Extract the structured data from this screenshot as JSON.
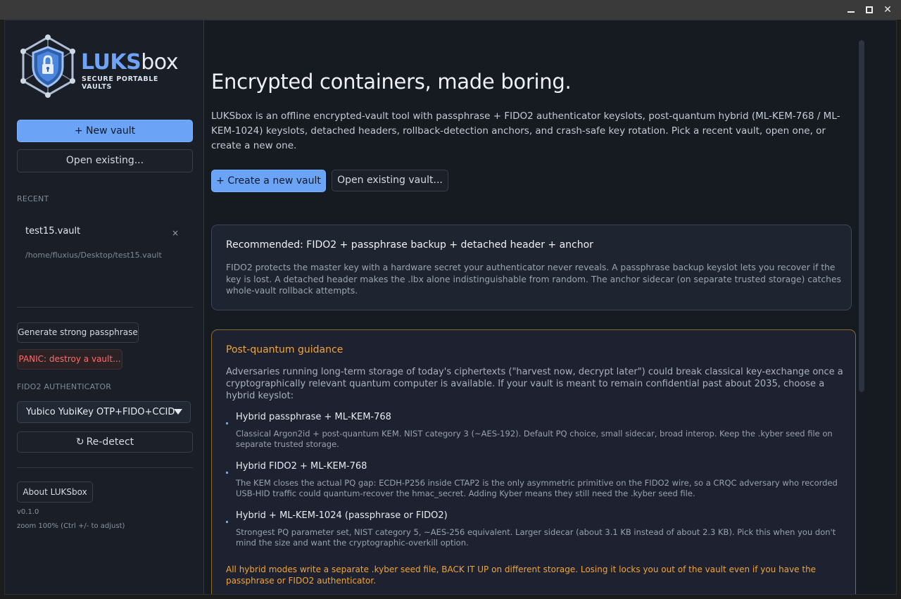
{
  "window": {
    "controls": {
      "minimize": "",
      "maximize": "",
      "close": ""
    }
  },
  "sidebar": {
    "logo": {
      "name_a": "LUKS",
      "name_b": "box",
      "tagline": "SECURE PORTABLE VAULTS"
    },
    "new_vault": "+ New vault",
    "open_existing": "Open existing...",
    "recent_label": "RECENT",
    "recent": [
      {
        "name": "test15.vault",
        "path": "/home/fluxius/Desktop/test15.vault",
        "remove": "×"
      }
    ],
    "generate_passphrase": "Generate strong passphrase",
    "panic": "PANIC: destroy a vault...",
    "fido_label": "FIDO2 AUTHENTICATOR",
    "fido_device": "Yubico YubiKey OTP+FIDO+CCID",
    "redetect_icon": "↻",
    "redetect": "Re-detect",
    "about": "About LUKSbox",
    "version": "v0.1.0",
    "zoom": "zoom 100%  (Ctrl +/- to adjust)"
  },
  "main": {
    "heading": "Encrypted containers, made boring.",
    "intro": "LUKSbox is an offline encrypted-vault tool with passphrase + FIDO2 authenticator keyslots, post-quantum hybrid (ML-KEM-768 / ML-KEM-1024) keyslots, detached headers, rollback-detection anchors, and crash-safe key rotation. Pick a recent vault, open one, or create a new one.",
    "create_button": "+ Create a new vault",
    "open_button": "Open existing vault...",
    "recommended": {
      "title": "Recommended: FIDO2 + passphrase backup + detached header + anchor",
      "body": "FIDO2 protects the master key with a hardware secret your authenticator never reveals. A passphrase backup keyslot lets you recover if the key is lost. A detached header makes the .lbx alone indistinguishable from random. The anchor sidecar (on separate trusted storage) catches whole-vault rollback attempts."
    },
    "pq": {
      "title": "Post-quantum guidance",
      "body": "Adversaries running long-term storage of today's ciphertexts (\"harvest now, decrypt later\") could break classical key-exchange once a cryptographically relevant quantum computer is available. If your vault is meant to remain confidential past about 2035, choose a hybrid keyslot:",
      "options": [
        {
          "title": "Hybrid passphrase + ML-KEM-768",
          "body": "Classical Argon2id + post-quantum KEM. NIST category 3 (~AES-192). Default PQ choice, small sidecar, broad interop. Keep the .kyber seed file on separate trusted storage."
        },
        {
          "title": "Hybrid FIDO2 + ML-KEM-768",
          "body": "The KEM closes the actual PQ gap: ECDH-P256 inside CTAP2 is the only asymmetric primitive on the FIDO2 wire, so a CRQC adversary who recorded USB-HID traffic could quantum-recover the hmac_secret. Adding Kyber means they still need the .kyber seed file."
        },
        {
          "title": "Hybrid + ML-KEM-1024 (passphrase or FIDO2)",
          "body": "Strongest PQ parameter set, NIST category 5, ~AES-256 equivalent. Larger sidecar (about 3.1 KB instead of about 2.3 KB). Pick this when you don't mind the size and want the cryptographic-overkill option."
        }
      ],
      "warning": "All hybrid modes write a separate .kyber seed file, BACK IT UP on different storage. Losing it locks you out of the vault even if you have the passphrase or FIDO2 authenticator."
    }
  },
  "colors": {
    "accent": "#6ba3f7",
    "warning": "#f0a43a",
    "danger": "#ff6b6b",
    "background": "#161a21"
  }
}
